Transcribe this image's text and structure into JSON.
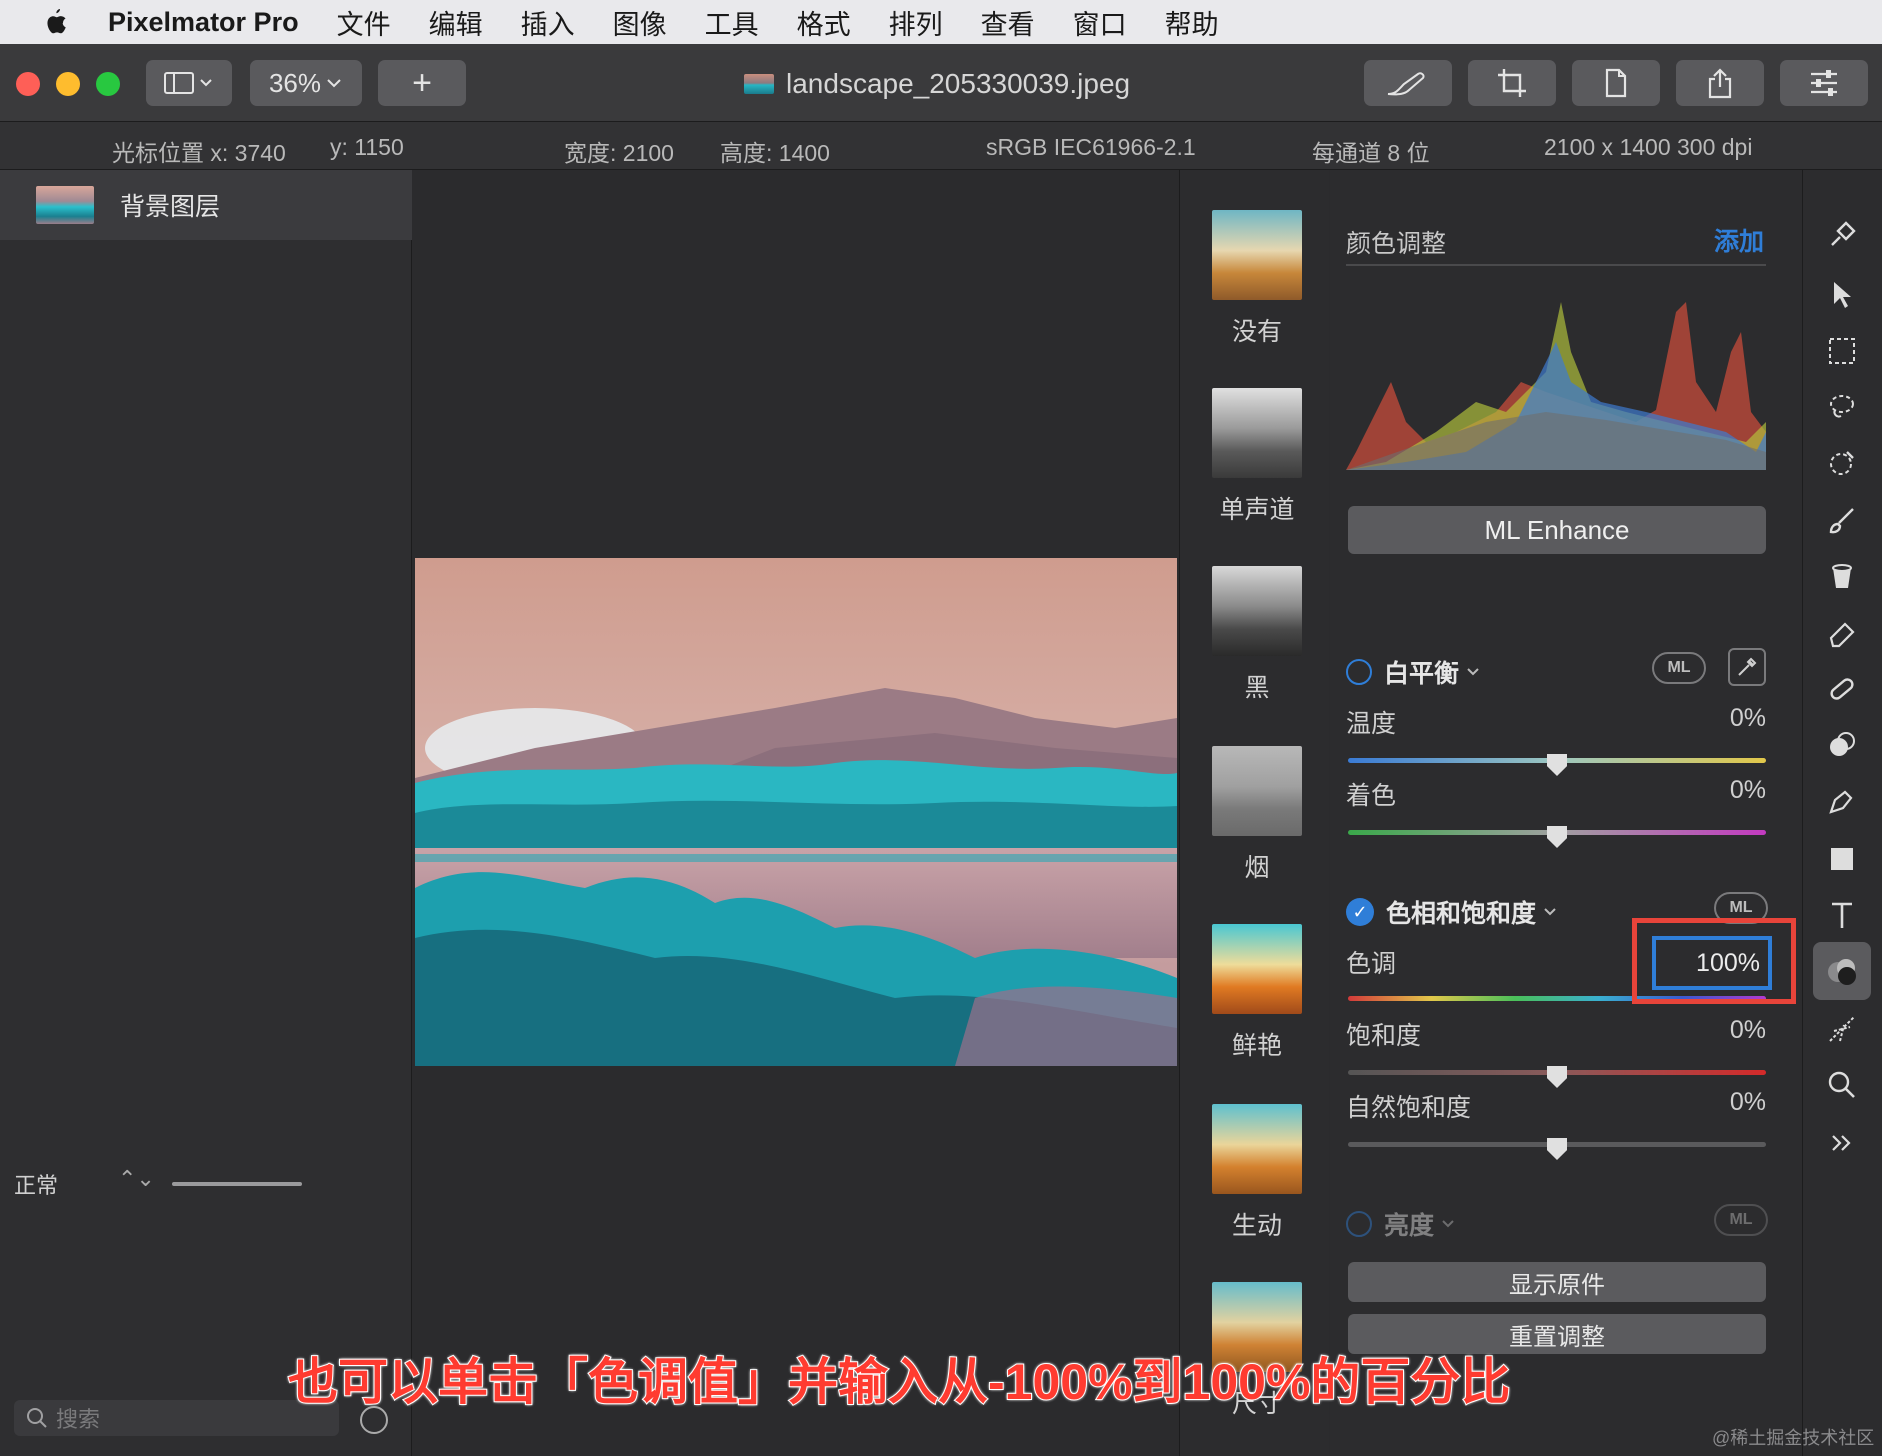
{
  "menubar": {
    "app_name": "Pixelmator Pro",
    "items": [
      "文件",
      "编辑",
      "插入",
      "图像",
      "工具",
      "格式",
      "排列",
      "查看",
      "窗口",
      "帮助"
    ]
  },
  "toolbar": {
    "zoom": "36%",
    "add": "+",
    "document_title": "landscape_205330039.jpeg"
  },
  "infobar": {
    "cursor_x": "光标位置 x:  3740",
    "cursor_y": "y:  1150",
    "width": "宽度:  2100",
    "height": "高度:  1400",
    "color_profile": "sRGB IEC61966-2.1",
    "bits": "每通道 8 位",
    "resolution": "2100 x 1400 300 dpi"
  },
  "layers": {
    "items": [
      {
        "label": "背景图层"
      }
    ],
    "blend_mode": "正常",
    "search_placeholder": "搜索"
  },
  "presets": [
    {
      "label": "没有"
    },
    {
      "label": "单声道"
    },
    {
      "label": "黑"
    },
    {
      "label": "烟"
    },
    {
      "label": "鲜艳"
    },
    {
      "label": "生动"
    },
    {
      "label": "尺寸"
    }
  ],
  "adjustments": {
    "title": "颜色调整",
    "add_label": "添加",
    "ml_enhance": "ML Enhance",
    "ml_badge": "ML",
    "white_balance": {
      "label": "白平衡",
      "temperature": {
        "label": "温度",
        "value": "0%",
        "level": 0.5
      },
      "tint": {
        "label": "着色",
        "value": "0%",
        "level": 0.5
      }
    },
    "hue_saturation": {
      "label": "色相和饱和度",
      "tone": {
        "label": "色调",
        "value": "100%",
        "level": 1.0
      },
      "saturation": {
        "label": "饱和度",
        "value": "0%",
        "level": 0.5
      },
      "vibrance": {
        "label": "自然饱和度",
        "value": "0%",
        "level": 0.5
      }
    },
    "brightness": {
      "label": "亮度"
    },
    "show_original": "显示原件",
    "reset": "重置调整"
  },
  "caption": "也可以单击「色调值」并输入从-100%到100%的百分比",
  "watermark": "@稀土掘金技术社区",
  "colors": {
    "accent": "#2f7ed8",
    "highlight": "#e8443a",
    "caption": "#ff3b30"
  }
}
